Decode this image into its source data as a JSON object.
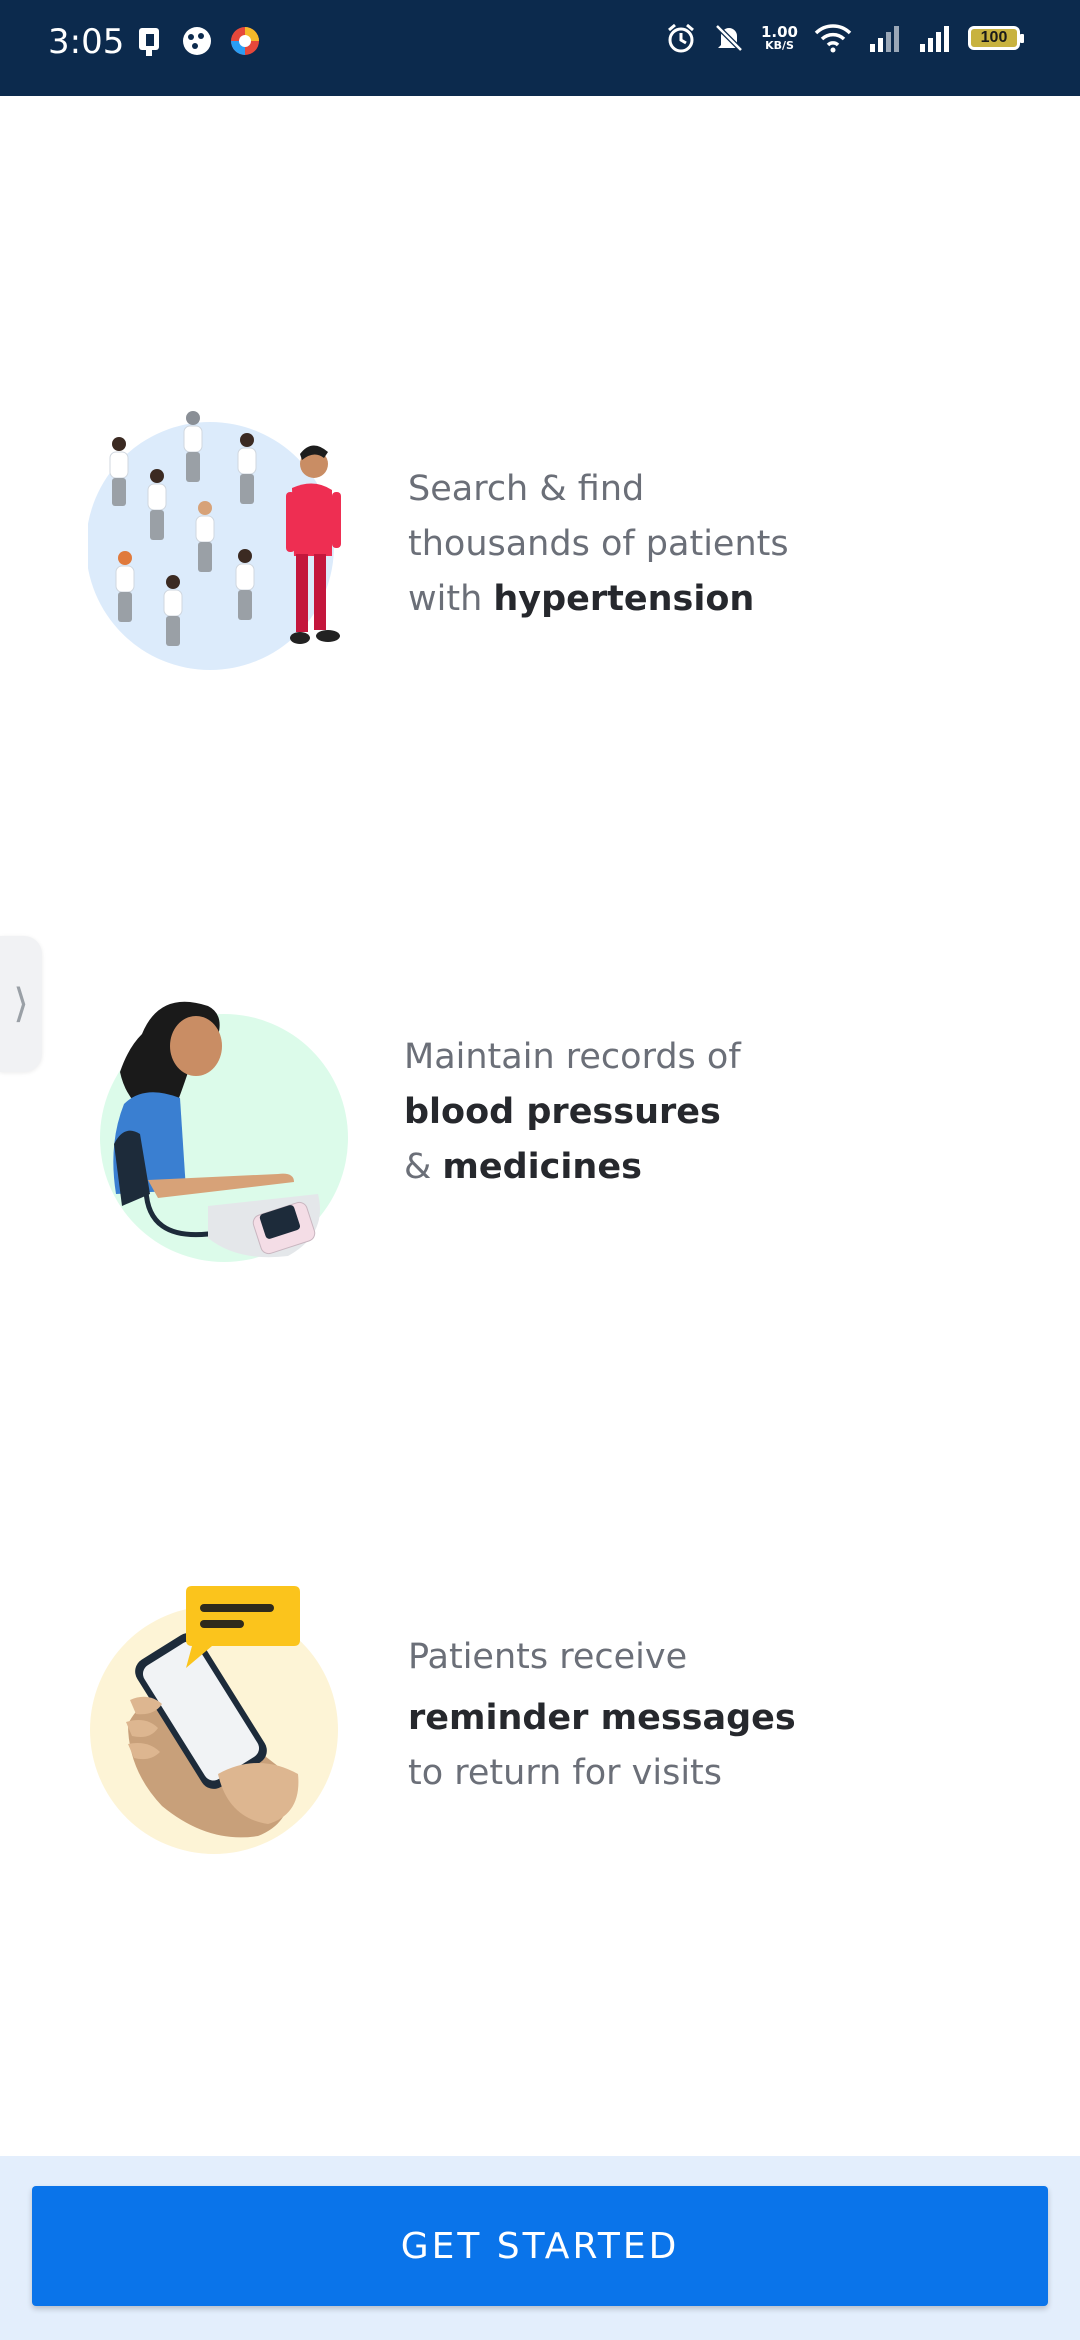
{
  "status_bar": {
    "time": "3:05",
    "net_speed_value": "1.00",
    "net_speed_unit": "KB/S",
    "battery": "100",
    "icons": [
      "sim-icon",
      "settings-icon",
      "browser-icon",
      "alarm-icon",
      "mute-icon",
      "wifi-icon",
      "signal-icon",
      "signal-icon",
      "battery-icon"
    ]
  },
  "features": [
    {
      "illustration": "patients-crowd-illustration",
      "line1": "Search & find",
      "line2": "thousands of patients",
      "line3_prefix": "with ",
      "line3_bold": "hypertension"
    },
    {
      "illustration": "blood-pressure-illustration",
      "line1": "Maintain records of",
      "line2_bold": "blood pressures",
      "line3_prefix": "& ",
      "line3_bold": "medicines"
    },
    {
      "illustration": "reminder-message-illustration",
      "line1": "Patients receive",
      "line2_bold": "reminder messages",
      "line3": "to return for visits"
    }
  ],
  "side_handle": "⟩",
  "cta": {
    "label": "GET STARTED"
  },
  "colors": {
    "status_bar": "#0c2a4d",
    "primary": "#0a74ea",
    "bottom_area": "#e3eefc"
  }
}
